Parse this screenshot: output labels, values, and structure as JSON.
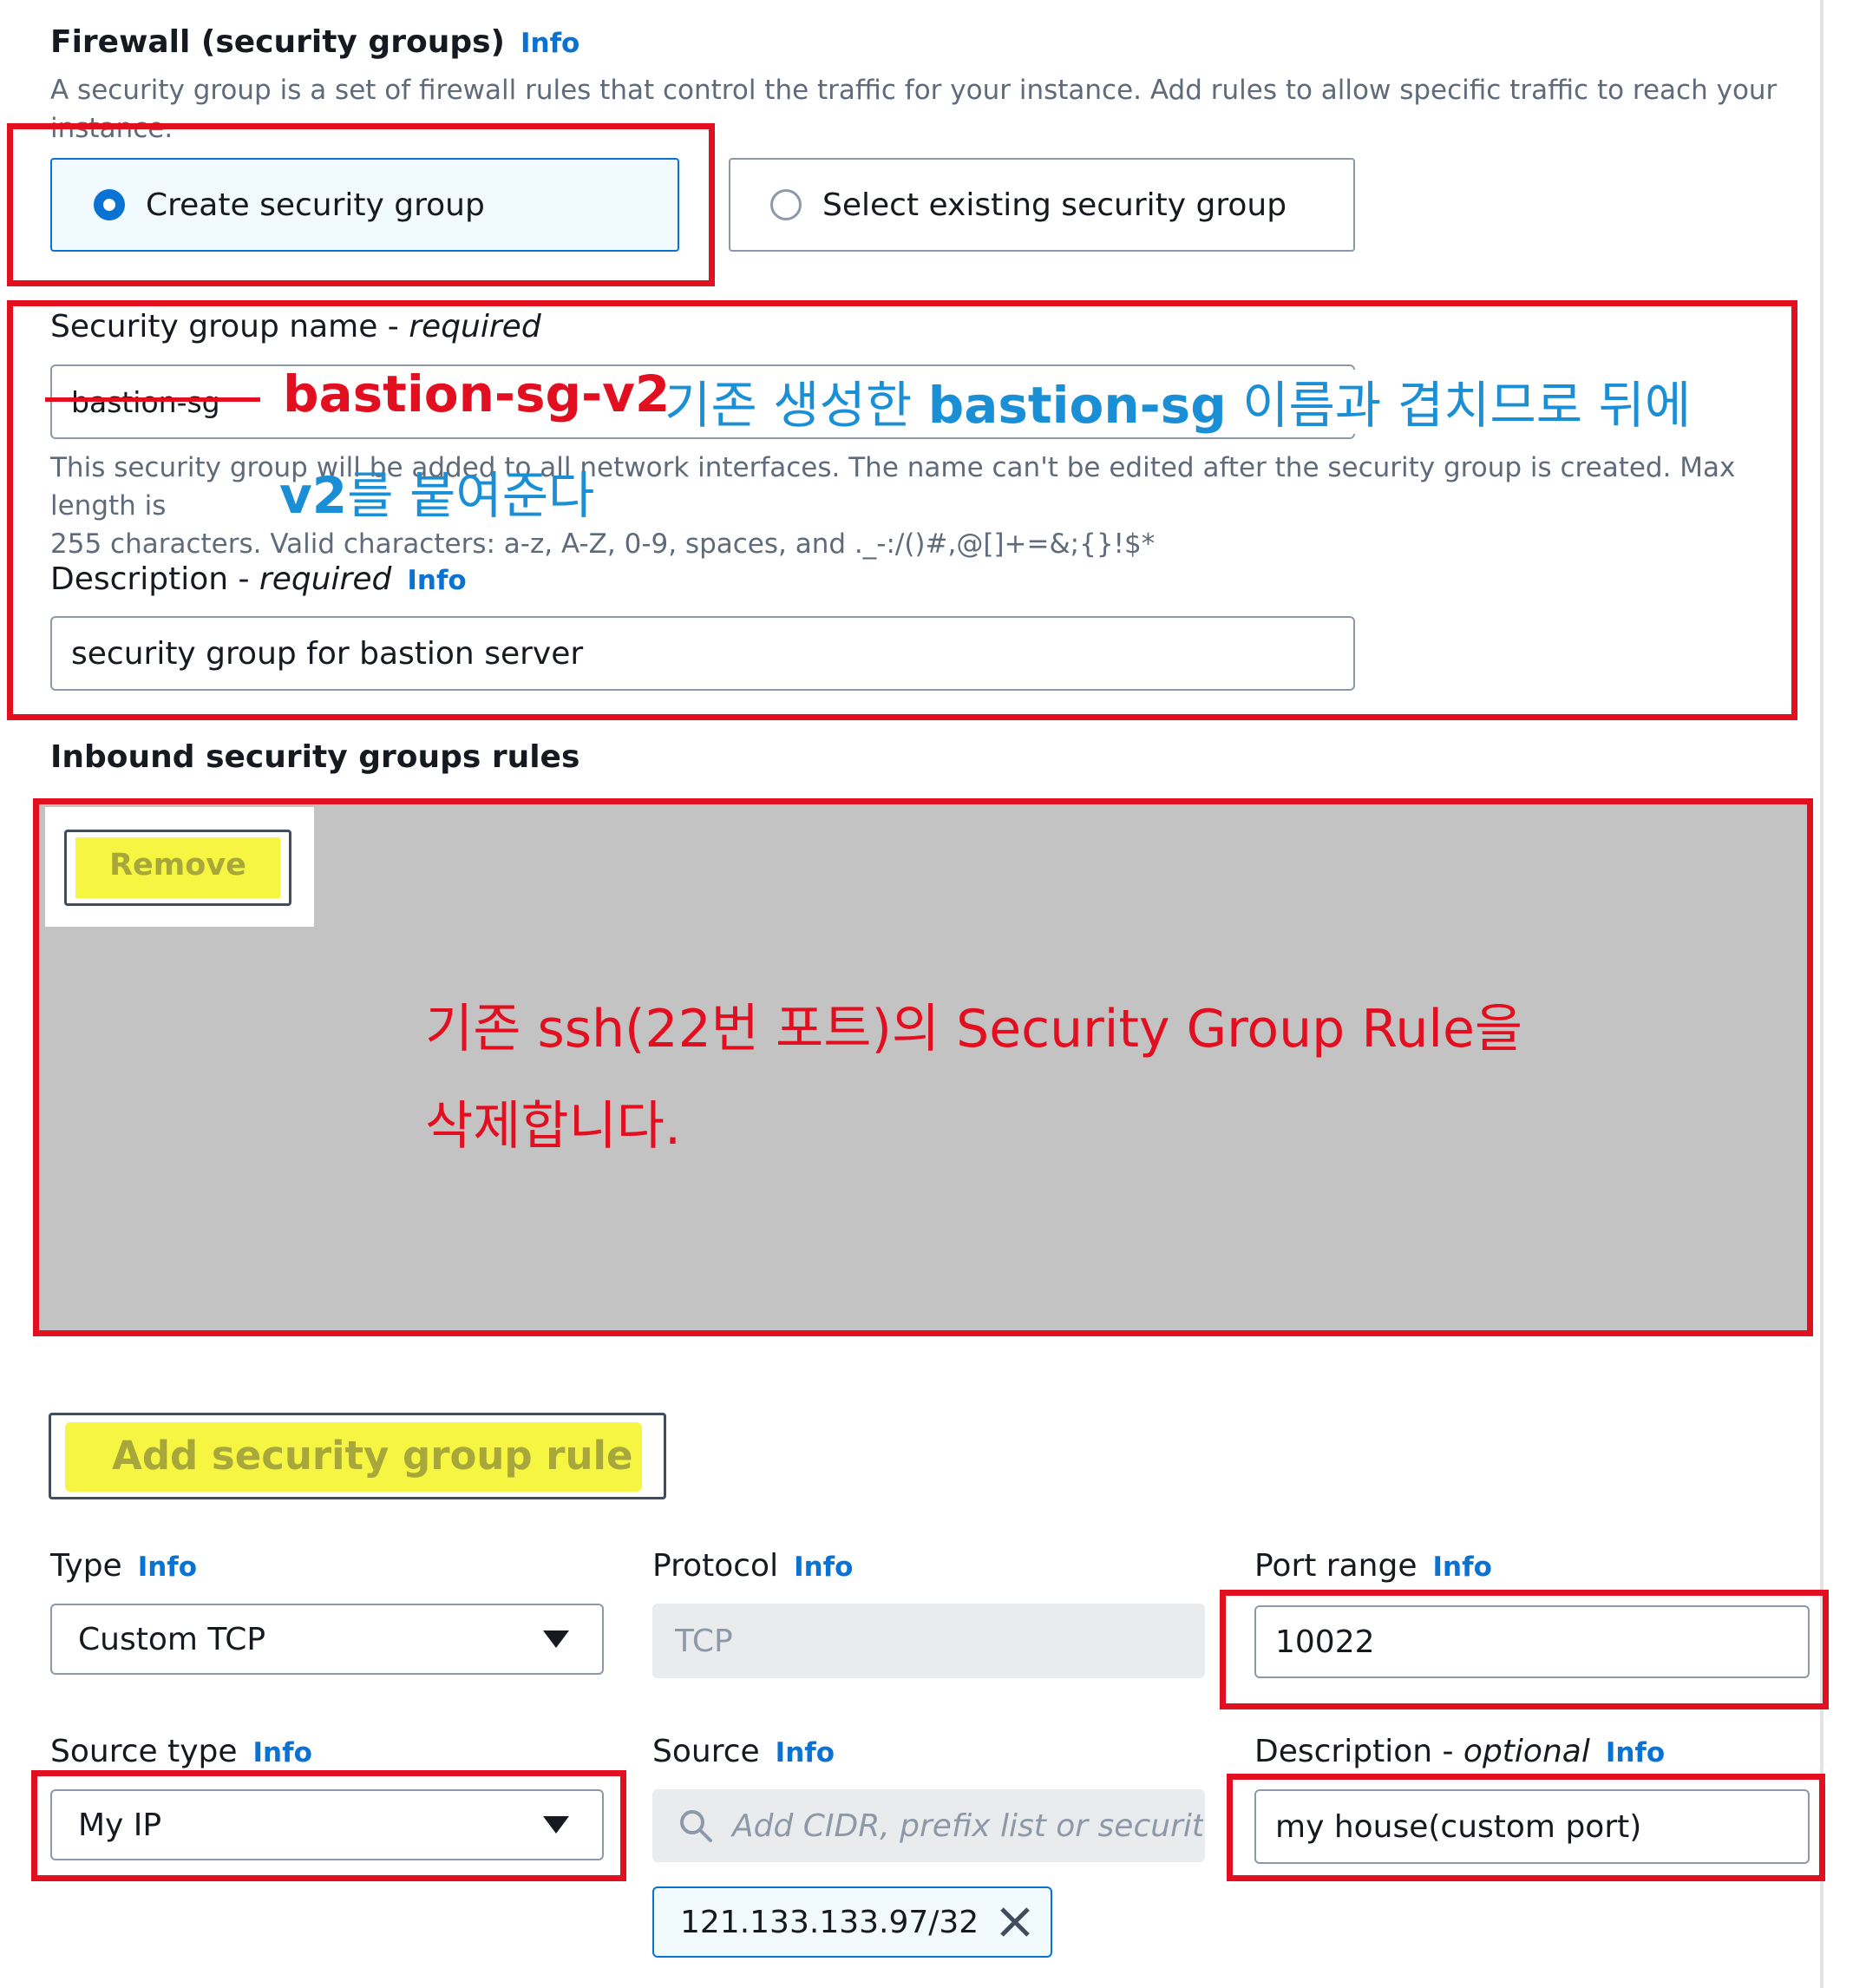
{
  "firewall": {
    "title": "Firewall (security groups)",
    "info": "Info",
    "description_line1": "A security group is a set of firewall rules that control the traffic for your instance. Add rules to allow specific traffic to reach your",
    "description_line2": "instance.",
    "options": [
      {
        "label": "Create security group",
        "selected": true
      },
      {
        "label": "Select existing security group",
        "selected": false
      }
    ]
  },
  "sg_name": {
    "label": "Security group name - ",
    "required": "required",
    "value": "bastion-sg",
    "help_line1": "This security group will be added to all network interfaces. The name can't be edited after the security group is created. Max length is",
    "help_line2": "255 characters. Valid characters: a-z, A-Z, 0-9, spaces, and ._-:/()#,@[]+=&;{}!$*"
  },
  "sg_description": {
    "label": "Description - ",
    "required": "required",
    "info": "Info",
    "value": "security group for bastion server"
  },
  "inbound": {
    "title": "Inbound security groups rules",
    "remove_button": "Remove",
    "add_rule_button": "Add security group rule"
  },
  "rule": {
    "type_label": "Type",
    "type_value": "Custom TCP",
    "protocol_label": "Protocol",
    "protocol_value": "TCP",
    "port_label": "Port range",
    "port_value": "10022",
    "source_type_label": "Source type",
    "source_type_value": "My IP",
    "source_label": "Source",
    "source_placeholder": "Add CIDR, prefix list or security",
    "source_token": "121.133.133.97/32",
    "desc_label": "Description - ",
    "desc_optional": "optional",
    "desc_value": "my house(custom port)",
    "info": "Info"
  },
  "annotations": {
    "new_name": "bastion-sg-v2",
    "blue_note_line1_a": "기존 생성한 ",
    "blue_note_line1_b": "bastion-sg",
    "blue_note_line1_c": " 이름과 겹치므로 뒤에",
    "blue_note_line2_a": "v2",
    "blue_note_line2_b": "를 붙여준다",
    "red_note_line1": "기존 ssh(22번 포트)의 Security Group Rule을",
    "red_note_line2": "삭제합니다."
  },
  "colors": {
    "annotation_red": "#e10f1f",
    "annotation_blue": "#1a8fd6",
    "aws_link": "#0972d3",
    "highlight_yellow": "#f5f542",
    "overlay_gray": "#c3c3c3"
  }
}
